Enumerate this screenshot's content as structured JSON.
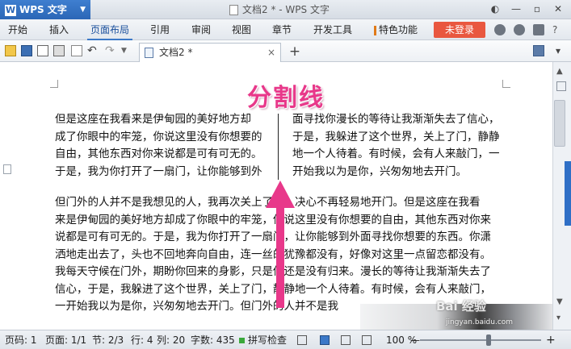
{
  "app": {
    "name": "WPS 文字",
    "logo_letter": "W",
    "window_title": "文档2 * - WPS 文字",
    "controls": [
      "—",
      "▫",
      "✕"
    ]
  },
  "menu": {
    "items": [
      "开始",
      "插入",
      "页面布局",
      "引用",
      "审阅",
      "视图",
      "章节",
      "开发工具",
      "特色功能"
    ],
    "active": "页面布局",
    "login_label": "未登录",
    "accent_color": "#e9573f"
  },
  "toolbar": {
    "tab_label": "文档2 *",
    "close_glyph": "×",
    "add_glyph": "+"
  },
  "document": {
    "annotation_title": "分割线",
    "left_column": [
      "但是这座在我看来是伊甸园的美好地方却",
      "成了你眼中的牢笼，你说这里没有你想要的",
      "自由，其他东西对你来说都是可有可无的。",
      "于是，我为你打开了一扇门，让你能够到外"
    ],
    "right_column": [
      "面寻找你漫长的等待让我渐渐失去了信心，",
      "于是，我躲进了这个世界，关上了门，静静",
      "地一个人待着。有时候，会有人来敲门，一",
      "开始我以为是你，兴匆匆地去开门。"
    ],
    "body_lines": [
      "    但门外的人并不是我想见的人，我再次关上了门，决心不再轻易地开门。但是这座在我看",
      "来是伊甸园的美好地方却成了你眼中的牢笼，你说这里没有你想要的自由，其他东西对你来",
      "说都是可有可无的。于是，我为你打开了一扇门，让你能够到外面寻找你想要的东西。你潇",
      "洒地走出去了，头也不回地奔向自由，连一丝的犹豫都没有，好像对这里一点留恋都没有。",
      "我每天守候在门外，期盼你回来的身影，只是你还是没有归来。漫长的等待让我渐渐失去了",
      "信心，于是，我躲进了这个世界，关上了门，静静地一个人待着。有时候，会有人来敲门，",
      "一开始我以为是你，兴匆匆地去开门。但门外的人并不是我"
    ],
    "watermark": "Bai 经验",
    "watermark_url": "jingyan.baidu.com",
    "annotation_color": "#e8388a"
  },
  "status": {
    "page_num": "页码: 1",
    "pages": "页面: 1/1",
    "section": "节: 2/3",
    "row": "行: 4",
    "column": "列: 20",
    "word_count": "字数: 435",
    "spell_check": "拼写检查",
    "zoom": "100 %",
    "zoom_minus": "—",
    "zoom_plus": "+"
  }
}
